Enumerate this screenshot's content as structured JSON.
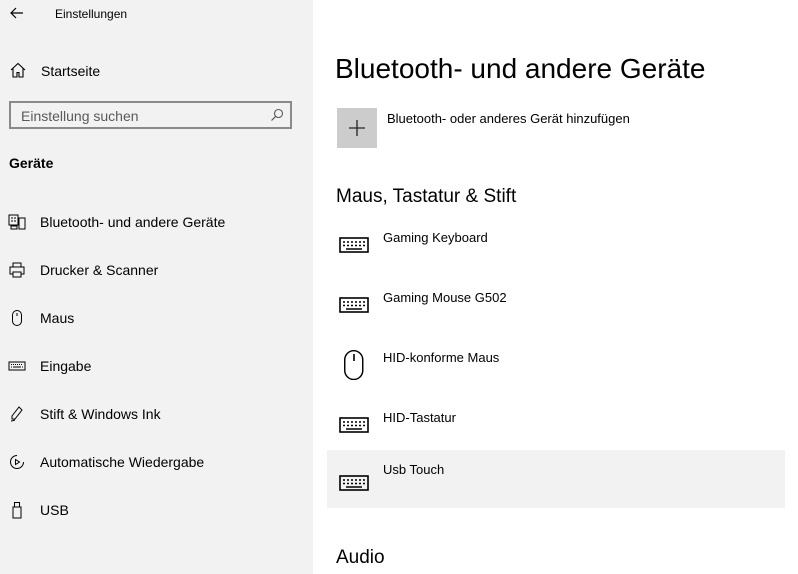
{
  "window": {
    "title": "Einstellungen",
    "back_icon": "back-arrow-icon"
  },
  "sidebar": {
    "home_label": "Startseite",
    "home_icon": "home-icon",
    "search_placeholder": "Einstellung suchen",
    "search_icon": "search-icon",
    "section_title": "Geräte",
    "items": [
      {
        "label": "Bluetooth- und andere Geräte",
        "icon": "bluetooth-devices-icon"
      },
      {
        "label": "Drucker & Scanner",
        "icon": "printer-icon"
      },
      {
        "label": "Maus",
        "icon": "mouse-icon"
      },
      {
        "label": "Eingabe",
        "icon": "keyboard-icon"
      },
      {
        "label": "Stift & Windows Ink",
        "icon": "pen-icon"
      },
      {
        "label": "Automatische Wiedergabe",
        "icon": "autoplay-icon"
      },
      {
        "label": "USB",
        "icon": "usb-icon"
      }
    ]
  },
  "main": {
    "title": "Bluetooth- und andere Geräte",
    "add_device_label": "Bluetooth- oder anderes Gerät hinzufügen",
    "add_icon": "plus-icon",
    "groups": [
      {
        "heading": "Maus, Tastatur & Stift",
        "devices": [
          {
            "name": "Gaming Keyboard",
            "icon": "keyboard-icon"
          },
          {
            "name": "Gaming Mouse G502",
            "icon": "keyboard-icon"
          },
          {
            "name": "HID-konforme Maus",
            "icon": "mouse-icon"
          },
          {
            "name": "HID-Tastatur",
            "icon": "keyboard-icon"
          },
          {
            "name": "Usb Touch",
            "icon": "keyboard-icon",
            "selected": true
          }
        ]
      },
      {
        "heading": "Audio",
        "devices": []
      }
    ]
  },
  "colors": {
    "sidebar_bg": "#f2f2f2",
    "selected_row_bg": "#f2f2f2",
    "add_tile_bg": "#cccccc"
  }
}
